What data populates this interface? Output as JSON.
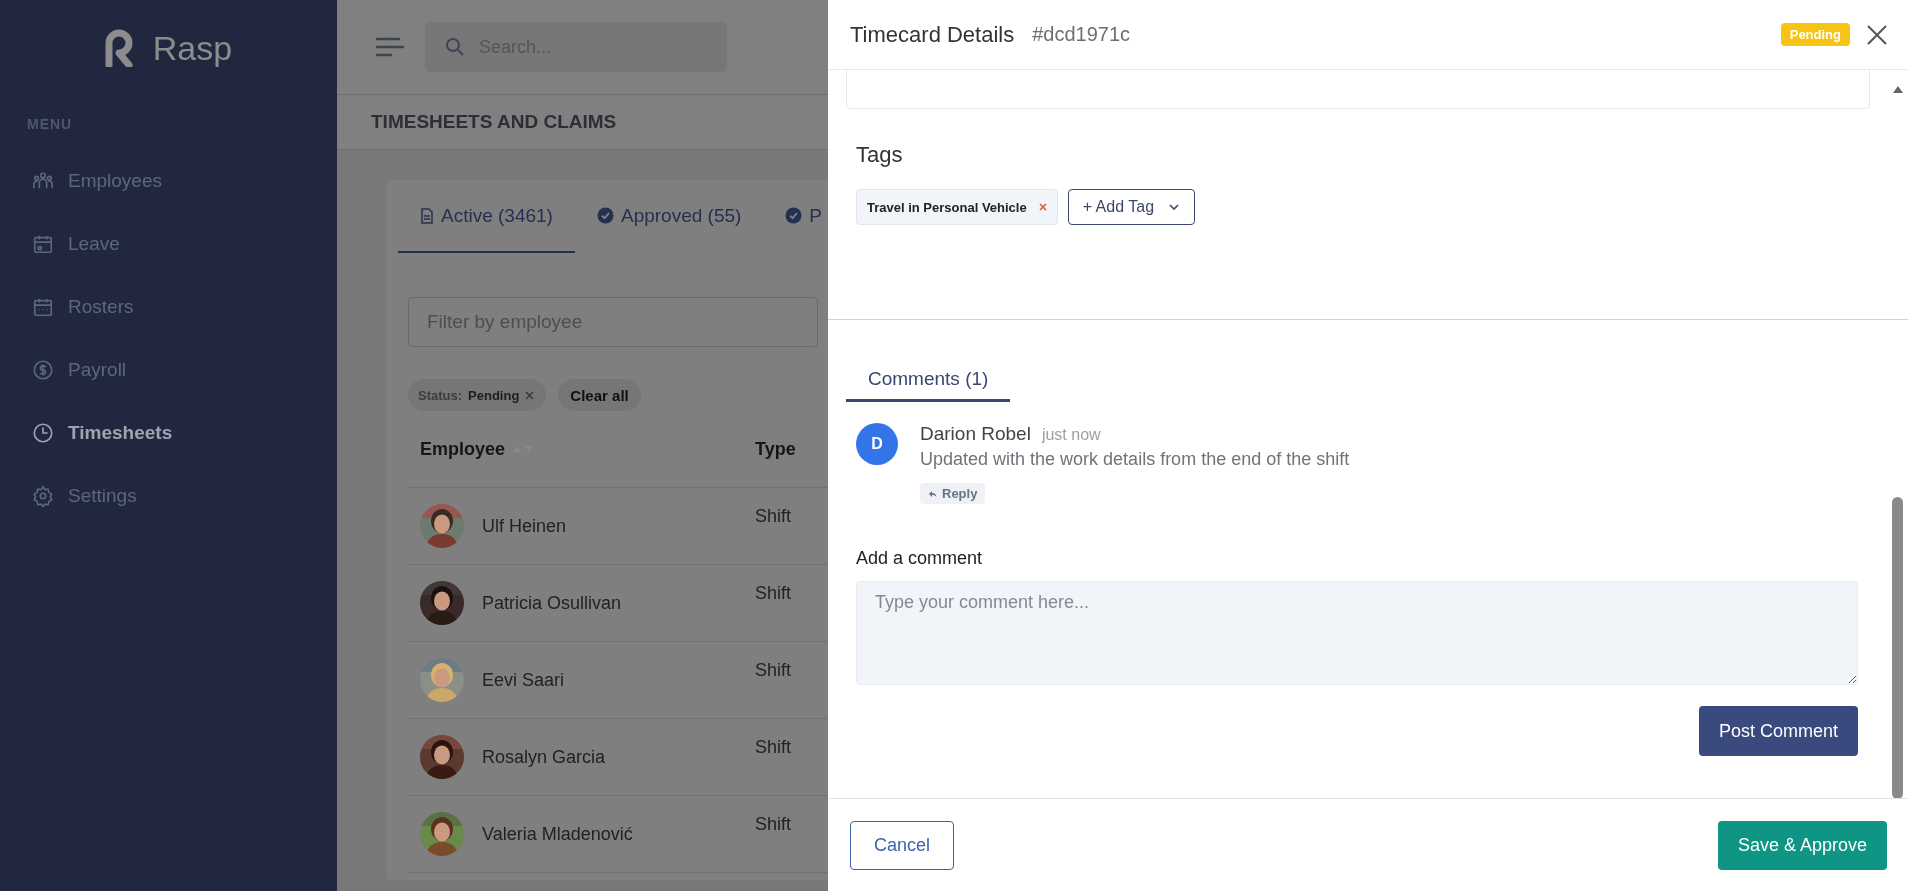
{
  "sidebar": {
    "logo": "Rasp",
    "section": "MENU",
    "items": [
      {
        "label": "Employees",
        "kind": "people",
        "selected": false
      },
      {
        "label": "Leave",
        "kind": "calendar",
        "selected": false
      },
      {
        "label": "Rosters",
        "kind": "roster",
        "selected": false
      },
      {
        "label": "Payroll",
        "kind": "dollar",
        "selected": false
      },
      {
        "label": "Timesheets",
        "kind": "clock",
        "selected": true
      },
      {
        "label": "Settings",
        "kind": "gear",
        "selected": false
      }
    ]
  },
  "topbar": {
    "search": {
      "placeholder": "Search..."
    }
  },
  "page_title": "TIMESHEETS AND CLAIMS",
  "tabs": [
    {
      "label": "Active (3461)",
      "kind": "document",
      "selected": true
    },
    {
      "label": "Approved (55)",
      "kind": "check",
      "selected": false
    },
    {
      "label": "P",
      "kind": "check",
      "selected": false
    }
  ],
  "filter": {
    "placeholder": "Filter by employee"
  },
  "active_filters": [
    {
      "label": "Status:",
      "value": "Pending"
    }
  ],
  "clear_all": "Clear all",
  "table": {
    "columns": [
      "Employee",
      "Type"
    ],
    "rows": [
      {
        "employee": "Ulf Heinen",
        "type": "Shift"
      },
      {
        "employee": "Patricia Osullivan",
        "type": "Shift"
      },
      {
        "employee": "Eevi Saari",
        "type": "Shift"
      },
      {
        "employee": "Rosalyn Garcia",
        "type": "Shift"
      },
      {
        "employee": "Valeria Mladenović",
        "type": "Shift"
      }
    ]
  },
  "panel": {
    "title": "Timecard Details",
    "id": "#dcd1971c",
    "status": "Pending",
    "tags_heading": "Tags",
    "tags": [
      "Travel in Personal Vehicle"
    ],
    "add_tag": "+ Add Tag",
    "comment_tabs": [
      {
        "label": "Comments (1)",
        "selected": true
      }
    ],
    "comments": [
      {
        "initial": "D",
        "author": "Darion Robel",
        "time": "just now",
        "text": "Updated with the work details from the end of the shift",
        "reply": "Reply"
      }
    ],
    "add_comment_label": "Add a comment",
    "comment_field": {
      "placeholder": "Type your comment here..."
    },
    "post_button": "Post Comment"
  },
  "footer": {
    "cancel": "Cancel",
    "save": "Save & Approve"
  }
}
